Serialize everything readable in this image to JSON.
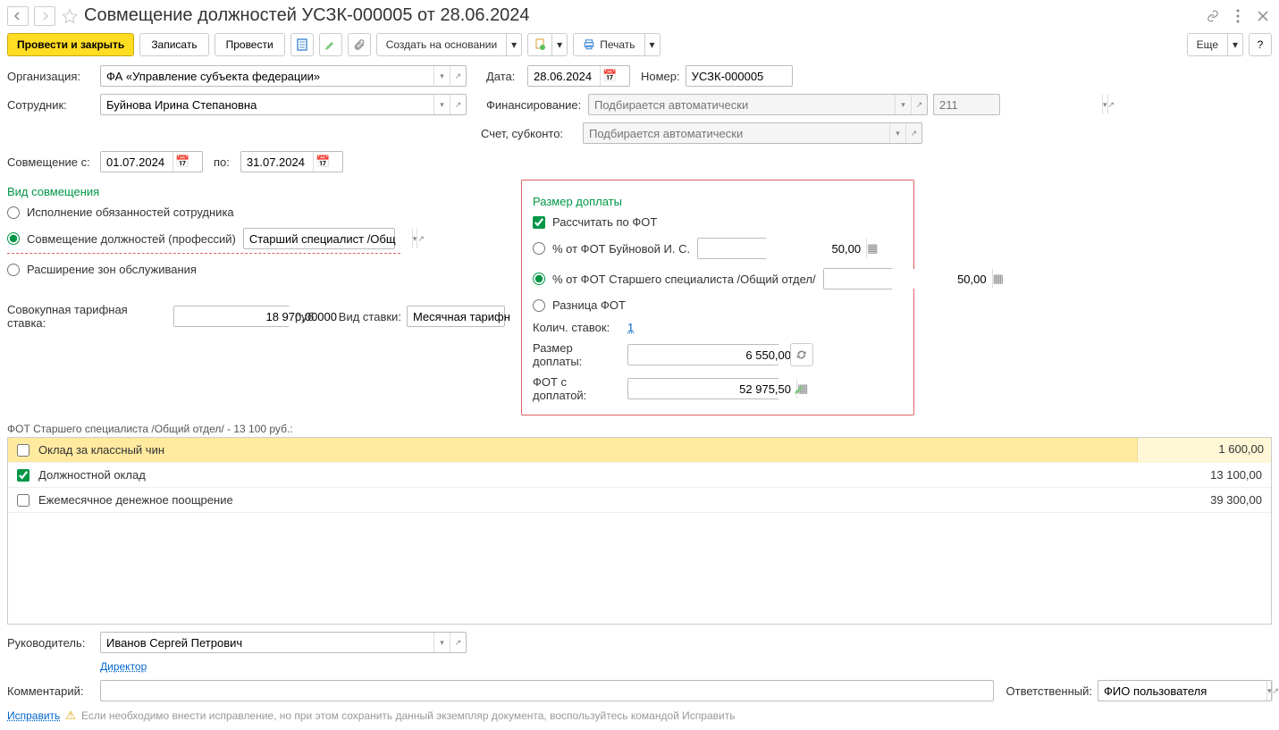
{
  "title": "Совмещение должностей УСЗК-000005 от 28.06.2024",
  "toolbar": {
    "post_close": "Провести и закрыть",
    "write": "Записать",
    "post": "Провести",
    "create_base": "Создать на основании",
    "print": "Печать",
    "more": "Еще"
  },
  "labels": {
    "org": "Организация:",
    "employee": "Сотрудник:",
    "date": "Дата:",
    "number": "Номер:",
    "finance": "Финансирование:",
    "account": "Счет, субконто:",
    "from": "Совмещение с:",
    "to": "по:",
    "type_title": "Вид совмещения",
    "r1": "Исполнение обязанностей сотрудника",
    "r2": "Совмещение должностей (профессий)",
    "r3": "Расширение зон обслуживания",
    "rate_total": "Совокупная тарифная ставка:",
    "rub": "руб.",
    "rate_type": "Вид ставки:",
    "box_title": "Размер доплаты",
    "calc_fot": "Рассчитать по ФОТ",
    "pct_emp": "% от ФОТ Буйновой И. С.",
    "pct_pos": "% от ФОТ Старшего специалиста /Общий отдел/",
    "diff": "Разница ФОТ",
    "stake_count": "Колич. ставок:",
    "surcharge": "Размер доплаты:",
    "fot_plus": "ФОТ с доплатой:",
    "manager": "Руководитель:",
    "manager_pos": "Директор",
    "comment": "Комментарий:",
    "responsible": "Ответственный:",
    "fix": "Исправить",
    "warning": "Если необходимо внести исправление, но при этом сохранить данный экземпляр документа, воспользуйтесь командой Исправить",
    "table_title": "ФОТ Старшего специалиста /Общий отдел/ - 13 100 руб.:"
  },
  "fields": {
    "org": "ФА «Управление субъекта федерации»",
    "employee": "Буйнова Ирина Степановна",
    "date": "28.06.2024",
    "number": "УСЗК-000005",
    "finance_ph": "Подбирается автоматически",
    "fin_code": "211",
    "from": "01.07.2024",
    "to": "31.07.2024",
    "position": "Старший специалист /Общ",
    "rate_total": "18 970,00000",
    "rate_type": "Месячная тарифн",
    "pct_emp": "50,00",
    "pct_pos": "50,00",
    "stake_count": "1",
    "surcharge": "6 550,00",
    "fot_plus": "52 975,50",
    "manager": "Иванов Сергей Петрович",
    "responsible": "ФИО пользователя"
  },
  "table": {
    "rows": [
      {
        "checked": false,
        "name": "Оклад за классный чин",
        "val": "1 600,00"
      },
      {
        "checked": true,
        "name": "Должностной оклад",
        "val": "13 100,00"
      },
      {
        "checked": false,
        "name": "Ежемесячное денежное поощрение",
        "val": "39 300,00"
      }
    ]
  }
}
